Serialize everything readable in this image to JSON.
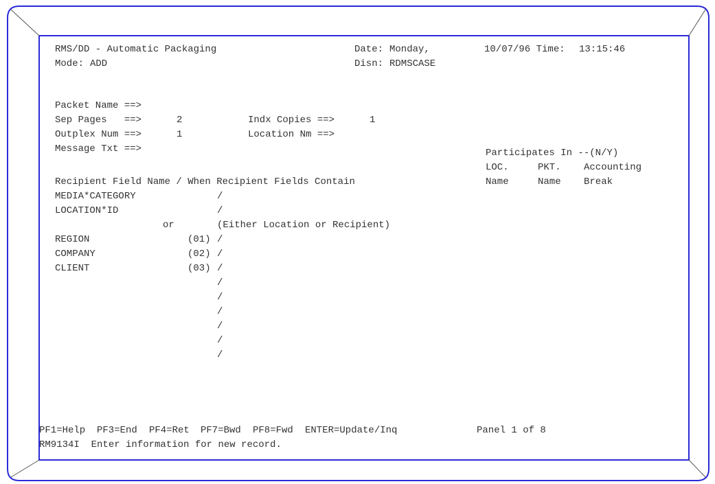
{
  "header": {
    "title": "RMS/DD - Automatic Packaging",
    "date_label": "Date:",
    "date_value": "Monday,",
    "datetime_label": "10/07/96 Time:",
    "time_value": "13:15:46",
    "mode_label": "Mode:",
    "mode_value": "ADD",
    "disn_label": "Disn:",
    "disn_value": "RDMSCASE"
  },
  "form": {
    "packet_name_label": "Packet Name ==>",
    "packet_name_value": "",
    "sep_pages_label": "Sep Pages   ==>",
    "sep_pages_value": "2",
    "indx_copies_label": "Indx Copies ==>",
    "indx_copies_value": "1",
    "outplex_num_label": "Outplex Num ==>",
    "outplex_num_value": "1",
    "location_nm_label": "Location Nm ==>",
    "location_nm_value": "",
    "message_txt_label": "Message Txt ==>",
    "message_txt_value": ""
  },
  "participates": {
    "title": "Participates In --(N/Y)",
    "col1_top": "LOC.",
    "col2_top": "PKT.",
    "col3_top": "Accounting",
    "col1_bottom": "Name",
    "col2_bottom": "Name",
    "col3_bottom": "Break"
  },
  "recipient": {
    "header": "Recipient Field Name / When Recipient Fields Contain",
    "rows": [
      {
        "name": "MEDIA*CATEGORY",
        "num": "",
        "sep": "/"
      },
      {
        "name": "LOCATION*ID",
        "num": "",
        "sep": "/"
      }
    ],
    "or_label": "or",
    "or_note": "(Either Location or Recipient)",
    "fields": [
      {
        "name": "REGION",
        "num": "(01)",
        "sep": "/"
      },
      {
        "name": "COMPANY",
        "num": "(02)",
        "sep": "/"
      },
      {
        "name": "CLIENT",
        "num": "(03)",
        "sep": "/"
      },
      {
        "name": "",
        "num": "",
        "sep": "/"
      },
      {
        "name": "",
        "num": "",
        "sep": "/"
      },
      {
        "name": "",
        "num": "",
        "sep": "/"
      },
      {
        "name": "",
        "num": "",
        "sep": "/"
      },
      {
        "name": "",
        "num": "",
        "sep": "/"
      },
      {
        "name": "",
        "num": "",
        "sep": "/"
      }
    ]
  },
  "footer": {
    "pf_keys": [
      "PF1=Help",
      "PF3=End",
      "PF4=Ret",
      "PF7=Bwd",
      "PF8=Fwd",
      "ENTER=Update/Inq"
    ],
    "panel": "Panel 1 of 8",
    "message": "RM9134I  Enter information for new record."
  },
  "colors": {
    "frame": "#2a2ad8",
    "text": "#333333"
  }
}
